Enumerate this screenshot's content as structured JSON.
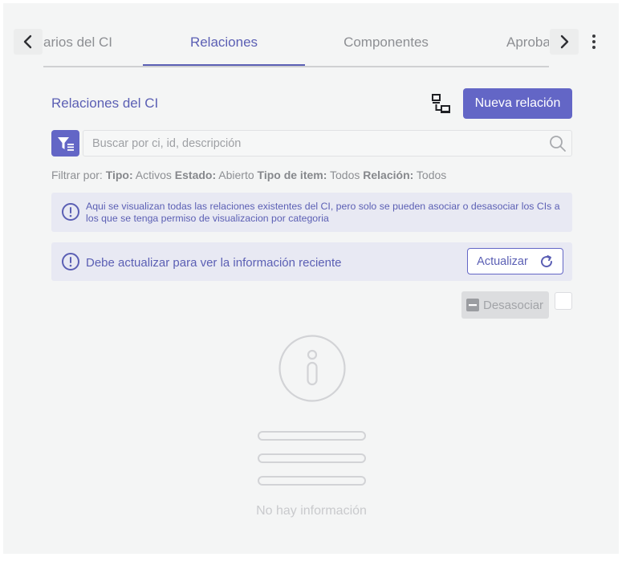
{
  "tabs": {
    "items": [
      {
        "label": "arios del CI"
      },
      {
        "label": "Relaciones"
      },
      {
        "label": "Componentes"
      },
      {
        "label": "Aproba"
      }
    ],
    "active_index": 1
  },
  "header": {
    "title": "Relaciones del CI",
    "new_relation_label": "Nueva relación"
  },
  "search": {
    "placeholder": "Buscar por ci, id, descripción"
  },
  "filters": {
    "prefix": "Filtrar por:",
    "tipo_label": "Tipo:",
    "tipo_value": "Activos",
    "estado_label": "Estado:",
    "estado_value": "Abierto",
    "tipo_item_label": "Tipo de item:",
    "tipo_item_value": "Todos",
    "relacion_label": "Relación:",
    "relacion_value": "Todos"
  },
  "notice": {
    "text": "Aqui se visualizan todas las relaciones existentes del CI, pero solo se pueden asociar o desasociar los CIs a los que se tenga permiso de visualizacion por categoria"
  },
  "refresh": {
    "text": "Debe actualizar para ver la información reciente",
    "button_label": "Actualizar"
  },
  "actions": {
    "disassociate_label": "Desasociar"
  },
  "empty_state": {
    "text": "No hay información"
  },
  "colors": {
    "accent": "#6366c6",
    "accent_text": "#5b5fb4",
    "notice_bg": "#e8e9f3",
    "muted": "#8d8f93",
    "panel_bg": "#f4f5f5"
  }
}
